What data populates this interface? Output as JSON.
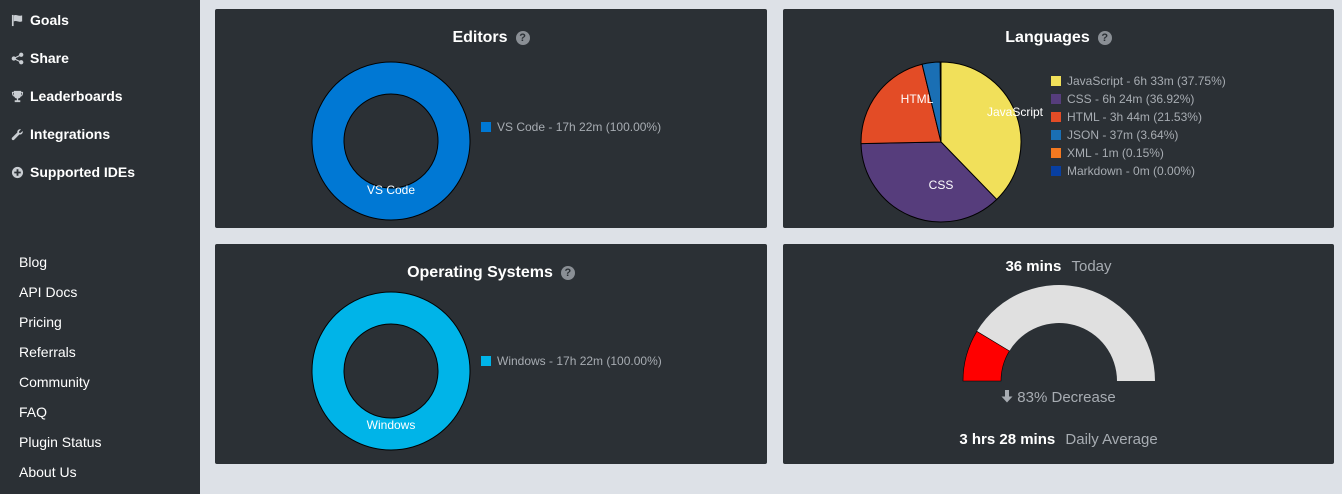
{
  "sidebar": {
    "nav": [
      {
        "label": "Goals",
        "icon": "flag-icon"
      },
      {
        "label": "Share",
        "icon": "share-icon"
      },
      {
        "label": "Leaderboards",
        "icon": "trophy-icon"
      },
      {
        "label": "Integrations",
        "icon": "wrench-icon"
      },
      {
        "label": "Supported IDEs",
        "icon": "plus-circle-icon"
      }
    ],
    "links": [
      "Blog",
      "API Docs",
      "Pricing",
      "Referrals",
      "Community",
      "FAQ",
      "Plugin Status",
      "About Us"
    ]
  },
  "editors": {
    "title": "Editors",
    "help_glyph": "?",
    "slice_label": "VS Code",
    "legend": [
      {
        "label": "VS Code - 17h 22m (100.00%)",
        "color": "#0078d4"
      }
    ]
  },
  "languages": {
    "title": "Languages",
    "help_glyph": "?",
    "slice_labels": {
      "javascript": "JavaScript",
      "css": "CSS",
      "html": "HTML"
    },
    "legend": [
      {
        "label": "JavaScript - 6h 33m (37.75%)",
        "color": "#f1e05a"
      },
      {
        "label": "CSS - 6h 24m (36.92%)",
        "color": "#563d7c"
      },
      {
        "label": "HTML - 3h 44m (21.53%)",
        "color": "#e34c26"
      },
      {
        "label": "JSON - 37m (3.64%)",
        "color": "#1a6fb4"
      },
      {
        "label": "XML - 1m (0.15%)",
        "color": "#f47920"
      },
      {
        "label": "Markdown - 0m (0.00%)",
        "color": "#083fa1"
      }
    ]
  },
  "os": {
    "title": "Operating Systems",
    "help_glyph": "?",
    "slice_label": "Windows",
    "legend": [
      {
        "label": "Windows - 17h 22m (100.00%)",
        "color": "#00b4e8"
      }
    ]
  },
  "today": {
    "value": "36 mins",
    "value_label": "Today",
    "change": "83% Decrease",
    "change_icon": "arrow-down-icon",
    "average": "3 hrs 28 mins",
    "average_label": "Daily Average",
    "gauge_fraction": 0.1731,
    "gauge_fill_color": "#ff0000",
    "gauge_track_color": "#e0e0e0"
  },
  "chart_data": [
    {
      "type": "pie",
      "title": "Editors",
      "categories": [
        "VS Code"
      ],
      "values": [
        100.0
      ]
    },
    {
      "type": "pie",
      "title": "Languages",
      "categories": [
        "JavaScript",
        "CSS",
        "HTML",
        "JSON",
        "XML",
        "Markdown"
      ],
      "values": [
        37.75,
        36.92,
        21.53,
        3.64,
        0.15,
        0.0
      ]
    },
    {
      "type": "pie",
      "title": "Operating Systems",
      "categories": [
        "Windows"
      ],
      "values": [
        100.0
      ]
    }
  ]
}
